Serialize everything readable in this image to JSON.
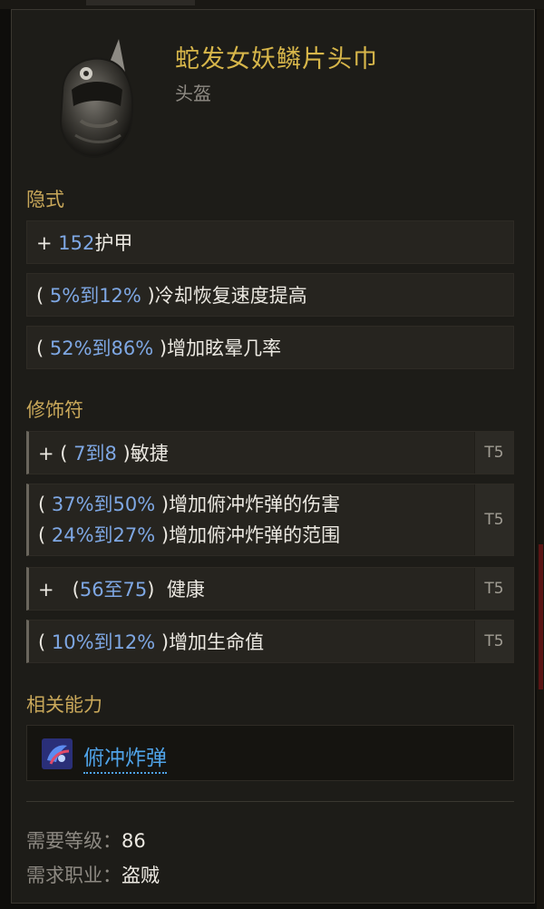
{
  "item": {
    "name": "蛇发女妖鳞片头巾",
    "type": "头盔",
    "icon": "hood-helmet-icon"
  },
  "sections": {
    "implicit_title": "隐式",
    "mods_title": "修饰符",
    "abilities_title": "相关能力"
  },
  "implicit": [
    {
      "pre": "+ ",
      "val": "152",
      "post": "护甲"
    },
    {
      "pre": "( ",
      "val": "5%到12%",
      "post": " )冷却恢复速度提高"
    },
    {
      "pre": "( ",
      "val": "52%到86%",
      "post": " )增加眩晕几率"
    }
  ],
  "mods": [
    {
      "lines": [
        {
          "pre": "+ ( ",
          "val": "7到8",
          "post": " )敏捷"
        }
      ],
      "tier": "T5"
    },
    {
      "lines": [
        {
          "pre": "( ",
          "val": "37%到50%",
          "post": " )增加俯冲炸弹的伤害"
        },
        {
          "pre": "( ",
          "val": "24%到27%",
          "post": " )增加俯冲炸弹的范围"
        }
      ],
      "tier": "T5"
    },
    {
      "lines": [
        {
          "pre": "+   (",
          "val": "56至75",
          "post": ")  健康"
        }
      ],
      "tier": "T5"
    },
    {
      "lines": [
        {
          "pre": "( ",
          "val": "10%到12%",
          "post": " )增加生命值"
        }
      ],
      "tier": "T5"
    }
  ],
  "ability": {
    "name": "俯冲炸弹",
    "icon": "dive-bomb-icon"
  },
  "requirements": {
    "level_label": "需要等级：",
    "level_value": "86",
    "class_label": "需求职业：",
    "class_value": "盗贼"
  }
}
